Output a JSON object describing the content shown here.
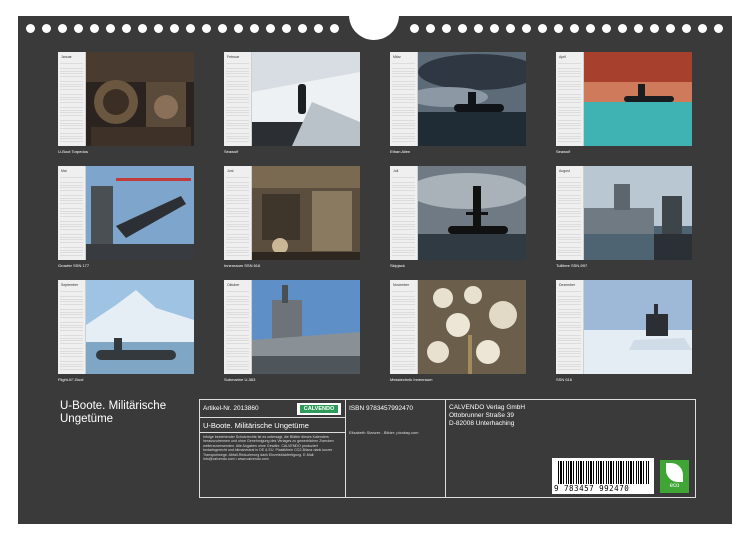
{
  "months": [
    {
      "cal_title": "Januar",
      "caption": "U-Boot Torpedos"
    },
    {
      "cal_title": "Februar",
      "caption": "Seawolf"
    },
    {
      "cal_title": "März",
      "caption": "Ethan Allen"
    },
    {
      "cal_title": "April",
      "caption": "Seawolf"
    },
    {
      "cal_title": "Mai",
      "caption": "Growler SSN 177"
    },
    {
      "cal_title": "Juni",
      "caption": "Innenraum SSN 616"
    },
    {
      "cal_title": "Juli",
      "caption": "Skipjack"
    },
    {
      "cal_title": "August",
      "caption": "Tullibee SSN-597"
    },
    {
      "cal_title": "September",
      "caption": "Flight-III\"-Boot"
    },
    {
      "cal_title": "Oktober",
      "caption": "Submarine U-363"
    },
    {
      "cal_title": "November",
      "caption": "Messtechnik Innenraum"
    },
    {
      "cal_title": "Dezember",
      "caption": "SSN 616"
    }
  ],
  "title": "U-Boote. Militärische Ungetüme",
  "info": {
    "article": "Artikel-Nr. 2013860",
    "logo": "CALVENDO",
    "subtitle": "U-Boote. Militärische Ungetüme",
    "fine_print": "Infolge bestehender Schutzrechte ist es untersagt, die Blätter dieses Kalenders herauszutrennen und ohne Genehmigung des Verlages zu gewerblichen Zwecken weiterzuverwenden. Alle Angaben ohne Gewähr. CALVENDO produziert bedarfsgerecht und klimaneutral in DE & EU. Plastikfreie CO2-Bilanz dank kurzer Transportwege. Abfall-Reduzierung dank Einzelstückfertigung. E-Mail: info@calvendo.com • www.calvendo.com",
    "isbn": "ISBN 9783457992470",
    "author": "Elisabeth Stanzer - Bilder: pixabay.com",
    "publisher": [
      "CALVENDO Verlag GmbH",
      "Ottobrunner Straße 39",
      "D-82008 Unterhaching"
    ],
    "barcode_number": "9 783457 992470",
    "eco_label": "eco"
  },
  "colors": {
    "board": "#3a3a3a",
    "eco": "#3fa535"
  }
}
